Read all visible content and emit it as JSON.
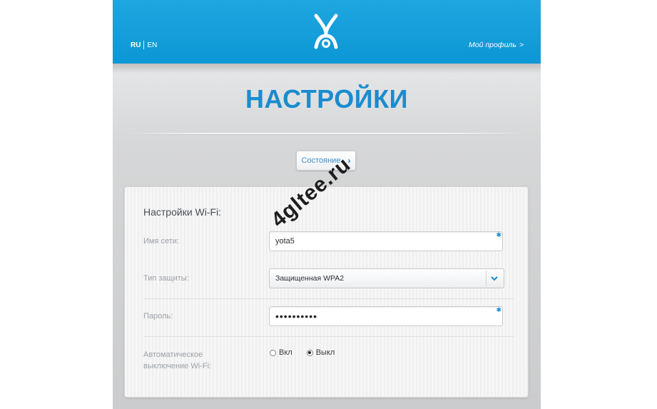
{
  "header": {
    "lang_ru": "RU",
    "lang_en": "EN",
    "profile_label": "Мой профиль",
    "profile_arrow": ">"
  },
  "page": {
    "title": "НАСТРОЙКИ",
    "status_button": "Состояние",
    "status_chevron": "›"
  },
  "wifi": {
    "section_title": "Настройки Wi-Fi:",
    "ssid_label": "Имя сети:",
    "ssid_value": "yota5",
    "security_label": "Тип защиты:",
    "security_value": "Защищенная WPA2",
    "password_label": "Пароль:",
    "password_value": "••••••••••",
    "auto_off_label_line1": "Автоматическое",
    "auto_off_label_line2": "выключение Wi-Fi:",
    "option_on": "Вкл",
    "option_off": "Выкл",
    "selected_option": "off"
  },
  "watermark": "4gltee.ru",
  "colors": {
    "header_blue": "#0b97d5",
    "title_blue": "#1a8ccf"
  }
}
